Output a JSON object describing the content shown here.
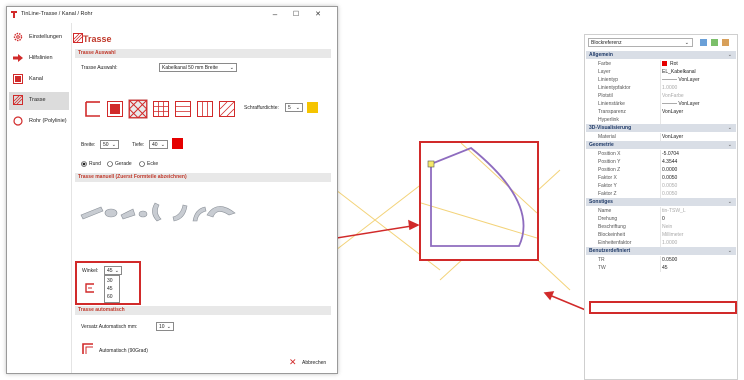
{
  "colors": {
    "accent_red": "#d12a2a",
    "brand_red": "#c0392b",
    "yellow_swatch": "#f5c400",
    "purple_shape": "#8e6cbf",
    "yellow_line": "#f3d37a"
  },
  "dialog": {
    "title": "TinLine-Trasse / Kanal / Rohr",
    "window_controls": {
      "minimize": "–",
      "maximize": "☐",
      "close": "✕"
    }
  },
  "sidebar": {
    "items": [
      {
        "label": "Einstellungen",
        "icon": "gear-icon"
      },
      {
        "label": "Hilfslinien",
        "icon": "arrow-right-icon"
      },
      {
        "label": "Kanal",
        "icon": "channel-icon"
      },
      {
        "label": "Trasse",
        "icon": "hatch-icon"
      },
      {
        "label": "Rohr (Polylinie)",
        "icon": "circle-icon"
      }
    ]
  },
  "content": {
    "title": "Trasse",
    "section_auswahl": "Trasse Auswahl",
    "auswahl_label": "Trasse Auswahl:",
    "auswahl_value": "Kabelkanal 50 mm Breite",
    "schraffurdichte_label": "Schraffurdichte:",
    "schraffurdichte_value": "5",
    "breite_label": "Breite:",
    "breite_value": "50",
    "tiefe_label": "Tiefe:",
    "tiefe_value": "40",
    "radio_rund": "Rund",
    "radio_gerade": "Gerade",
    "radio_ecke": "Ecke",
    "section_manuell": "Trasse manuell (Zuerst Formteile abzeichnen)",
    "winkel_label": "Winkel:",
    "winkel_value": "45",
    "winkel_options": [
      "30",
      "45",
      "60"
    ],
    "section_automatisch": "Trasse automatisch",
    "versatz_label": "Versatz Automatisch mm:",
    "versatz_value": "10",
    "auto_button_label": "Automatisch (90Grad)",
    "cancel_label": "Abbrechen"
  },
  "properties": {
    "selector": "Blockreferenz",
    "categories": [
      {
        "name": "Allgemein",
        "rows": [
          {
            "key": "Farbe",
            "value": "Rot",
            "swatch": true
          },
          {
            "key": "Layer",
            "value": "EL_Kabelkanal"
          },
          {
            "key": "Linientyp",
            "value": "——— VonLayer"
          },
          {
            "key": "Linientypfaktor",
            "value": "1.0000",
            "gray": true
          },
          {
            "key": "Plotstil",
            "value": "VonFarbe",
            "gray": true
          },
          {
            "key": "Linienstärke",
            "value": "——— VonLayer"
          },
          {
            "key": "Transparenz",
            "value": "VonLayer"
          },
          {
            "key": "Hyperlink",
            "value": ""
          }
        ]
      },
      {
        "name": "3D-Visualisierung",
        "rows": [
          {
            "key": "Material",
            "value": "VonLayer"
          }
        ]
      },
      {
        "name": "Geometrie",
        "rows": [
          {
            "key": "Position X",
            "value": "-5.0704"
          },
          {
            "key": "Position Y",
            "value": "4.3544"
          },
          {
            "key": "Position Z",
            "value": "0.0000"
          },
          {
            "key": "Faktor X",
            "value": "0.0050"
          },
          {
            "key": "Faktor Y",
            "value": "0.0050",
            "gray": true
          },
          {
            "key": "Faktor Z",
            "value": "0.0050",
            "gray": true
          }
        ]
      },
      {
        "name": "Sonstiges",
        "rows": [
          {
            "key": "Name",
            "value": "tin-TSW_L",
            "gray": true
          },
          {
            "key": "Drehung",
            "value": "0"
          },
          {
            "key": "Beschriftung",
            "value": "Nein",
            "gray": true
          },
          {
            "key": "Blockeinheit",
            "value": "Millimeter",
            "gray": true
          },
          {
            "key": "Einheitenfaktor",
            "value": "1.0000",
            "gray": true
          }
        ]
      },
      {
        "name": "Benutzerdefiniert",
        "rows": [
          {
            "key": "TR",
            "value": "0.0500"
          },
          {
            "key": "TW",
            "value": "45"
          }
        ]
      }
    ]
  }
}
